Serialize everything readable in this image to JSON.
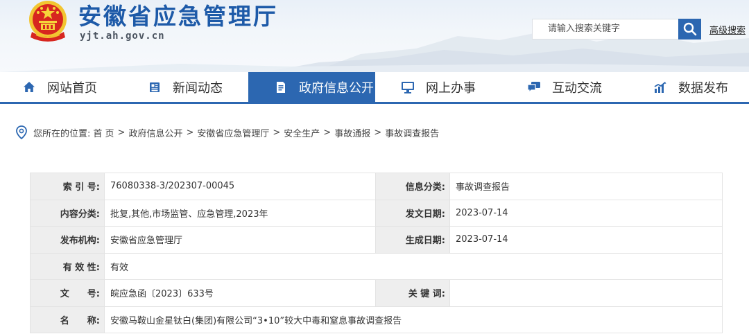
{
  "header": {
    "title": "安徽省应急管理厅",
    "domain": "yjt.ah.gov.cn",
    "search_placeholder": "请输入搜索关键字",
    "advanced_search": "高级搜索"
  },
  "nav": {
    "items": [
      {
        "label": "网站首页",
        "icon": "home-icon"
      },
      {
        "label": "新闻动态",
        "icon": "newspaper-icon"
      },
      {
        "label": "政府信息公开",
        "icon": "document-icon",
        "active": true
      },
      {
        "label": "网上办事",
        "icon": "monitor-icon"
      },
      {
        "label": "互动交流",
        "icon": "chat-icon"
      },
      {
        "label": "数据发布",
        "icon": "chart-icon"
      }
    ],
    "accent_color": "#2c67b1"
  },
  "breadcrumb": {
    "prefix": "您所在的位置:",
    "items": [
      "首 页",
      "政府信息公开",
      "安徽省应急管理厅",
      "安全生产",
      "事故通报",
      "事故调查报告"
    ],
    "separator": ">"
  },
  "info": {
    "index_label": "索 引 号:",
    "index_value": "76080338-3/202307-00045",
    "category_label": "信息分类:",
    "category_value": "事故调查报告",
    "content_label": "内容分类:",
    "content_value": "批复,其他,市场监管、应急管理,2023年",
    "pubdate_label": "发文日期:",
    "pubdate_value": "2023-07-14",
    "publisher_label": "发布机构:",
    "publisher_value": "安徽省应急管理厅",
    "gendate_label": "生成日期:",
    "gendate_value": "2023-07-14",
    "validity_label": "有 效 性:",
    "validity_value": "有效",
    "docno_label": "文　　号:",
    "docno_value": "皖应急函〔2023〕633号",
    "keywords_label": "关 键 词:",
    "keywords_value": "",
    "name_label": "名　　称:",
    "name_value": "安徽马鞍山金星钛白(集团)有限公司“3•10”较大中毒和窒息事故调查报告"
  }
}
